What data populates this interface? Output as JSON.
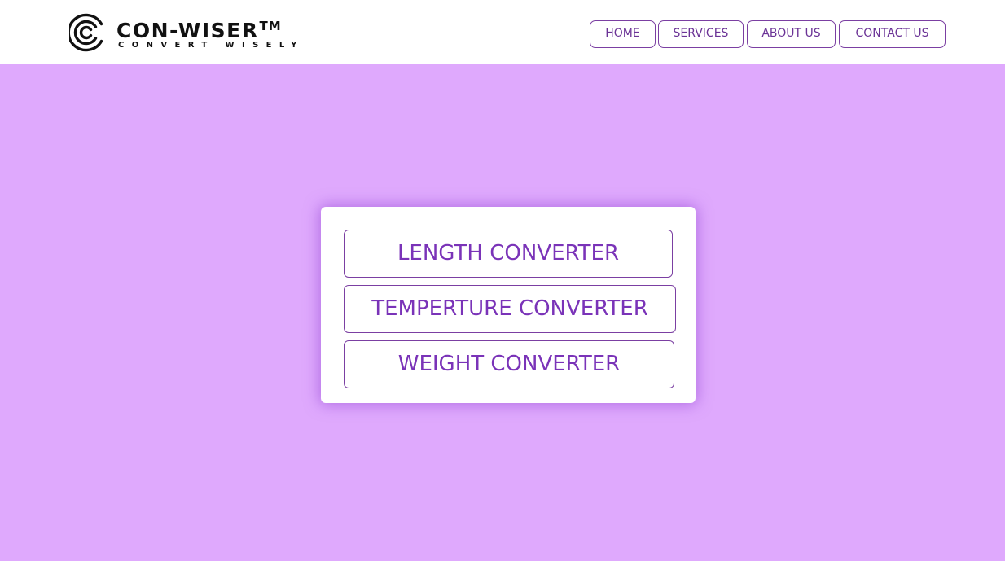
{
  "brand": {
    "name": "CON-WISER",
    "trademark": "TM",
    "tagline": "CONVERT WISELY",
    "logo_icon": "concentric-c-logo-icon"
  },
  "nav": {
    "items": [
      {
        "label": "HOME"
      },
      {
        "label": "SERVICES"
      },
      {
        "label": "ABOUT US"
      },
      {
        "label": "CONTACT US"
      }
    ]
  },
  "converters": {
    "items": [
      {
        "label": "LENGTH CONVERTER"
      },
      {
        "label": "TEMPERTURE CONVERTER"
      },
      {
        "label": "WEIGHT CONVERTER"
      }
    ]
  },
  "colors": {
    "background": "#dfa9fd",
    "accent": "#7a33b8",
    "border": "#7b3fa2",
    "header": "#ffffff"
  }
}
